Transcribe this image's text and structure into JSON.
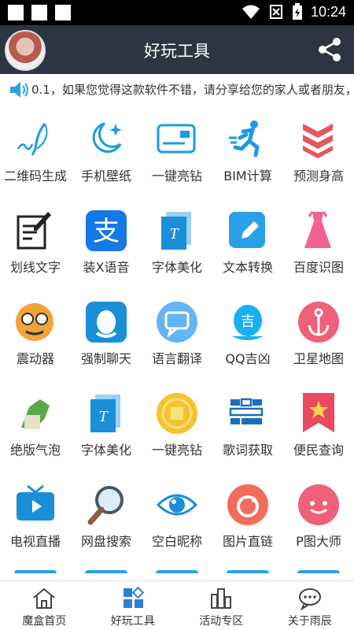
{
  "status_bar": {
    "time": "10:24"
  },
  "header": {
    "title": "好玩工具"
  },
  "marquee": {
    "text": "0.1，如果您觉得这款软件不错，请分享给您的家人或者朋友，"
  },
  "tools": [
    {
      "label": "二维码生成",
      "icon": "feather-pen-icon",
      "color": "#1a9be6"
    },
    {
      "label": "手机壁纸",
      "icon": "moon-stars-icon",
      "color": "#1a9be6"
    },
    {
      "label": "一键亮钻",
      "icon": "card-icon",
      "color": "#1a9be6"
    },
    {
      "label": "BIM计算",
      "icon": "running-man-icon",
      "color": "#1a9be6"
    },
    {
      "label": "预测身高",
      "icon": "layers-icon",
      "color": "#e8545f"
    },
    {
      "label": "划线文字",
      "icon": "edit-document-icon",
      "color": "#222222"
    },
    {
      "label": "装X语音",
      "icon": "alipay-icon",
      "color": "#1677e6"
    },
    {
      "label": "字体美化",
      "icon": "font-file-icon",
      "color": "#1a8fd8"
    },
    {
      "label": "文本转换",
      "icon": "pen-square-icon",
      "color": "#2aa0ea"
    },
    {
      "label": "百度识图",
      "icon": "dress-icon",
      "color": "#f06292"
    },
    {
      "label": "震动器",
      "icon": "glasses-face-icon",
      "color": "#f2a33a"
    },
    {
      "label": "强制聊天",
      "icon": "qq-penguin-icon",
      "color": "#1a8fd8"
    },
    {
      "label": "语言翻译",
      "icon": "chat-bubble-icon",
      "color": "#64b5f6"
    },
    {
      "label": "QQ吉凶",
      "icon": "qq-luck-icon",
      "color": "#1ab0f0"
    },
    {
      "label": "卫星地图",
      "icon": "anchor-icon",
      "color": "#f06078"
    },
    {
      "label": "绝版气泡",
      "icon": "dragon-icon",
      "color": "#5aa84a"
    },
    {
      "label": "字体美化",
      "icon": "font-file-icon",
      "color": "#1a8fd8"
    },
    {
      "label": "一键亮钻",
      "icon": "gold-coin-icon",
      "color": "#f4c430"
    },
    {
      "label": "歌词获取",
      "icon": "blocks-icon",
      "color": "#1a6fb8"
    },
    {
      "label": "便民查询",
      "icon": "bookmark-star-icon",
      "color": "#e84a5f"
    },
    {
      "label": "电视直播",
      "icon": "tv-icon",
      "color": "#1a8fd8"
    },
    {
      "label": "网盘搜索",
      "icon": "magnifier-icon",
      "color": "#455a64"
    },
    {
      "label": "空白昵称",
      "icon": "eye-icon",
      "color": "#1a8fd8"
    },
    {
      "label": "图片直链",
      "icon": "image-circle-icon",
      "color": "#f26b5b"
    },
    {
      "label": "P图大师",
      "icon": "smile-bubble-icon",
      "color": "#f0607a"
    }
  ],
  "bottom_nav": [
    {
      "label": "魔盒首页",
      "icon": "home-icon"
    },
    {
      "label": "好玩工具",
      "icon": "grid-apps-icon"
    },
    {
      "label": "活动专区",
      "icon": "activity-icon"
    },
    {
      "label": "关于雨辰",
      "icon": "chat-dots-icon"
    }
  ]
}
